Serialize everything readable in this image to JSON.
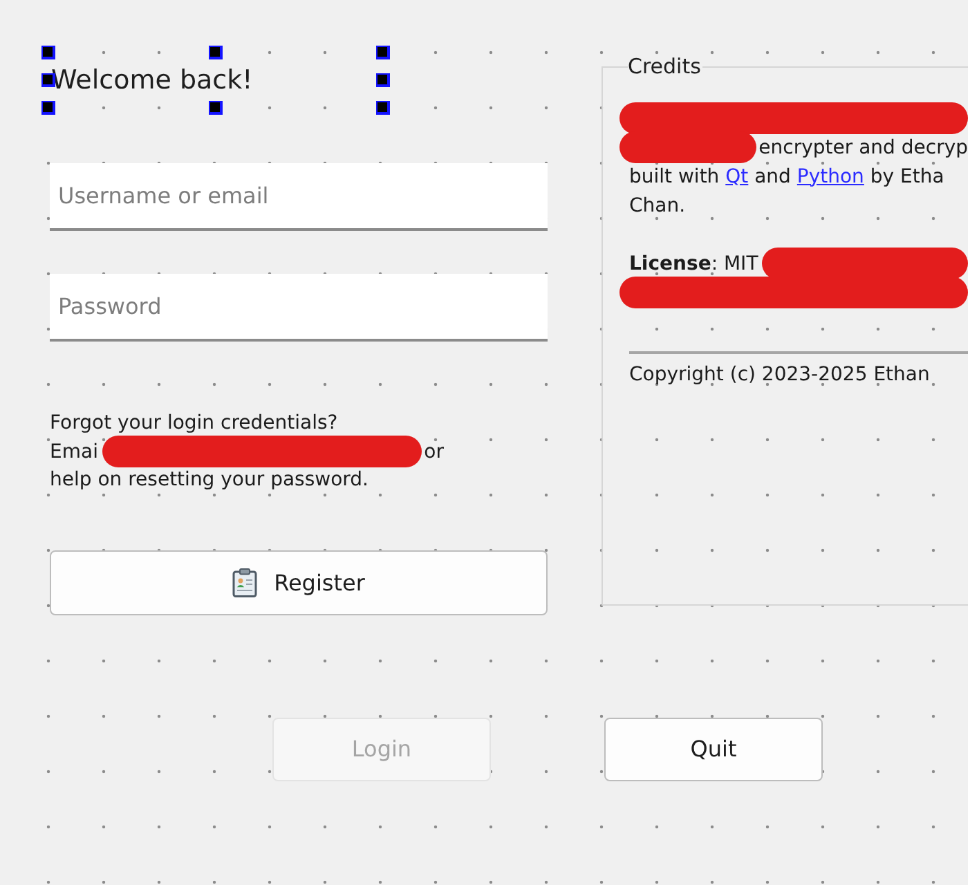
{
  "heading": {
    "text": "Welcome back!",
    "selected": true
  },
  "fields": [
    {
      "placeholder": "Username or email"
    },
    {
      "placeholder": "Password"
    }
  ],
  "help": {
    "lines": [
      [
        {
          "kind": "text",
          "text": "Forgot your login credentials?"
        }
      ],
      [
        {
          "kind": "text",
          "text": "Emai"
        },
        {
          "kind": "redaction"
        },
        {
          "kind": "text",
          "text": "or"
        }
      ],
      [
        {
          "kind": "text",
          "text": "help on resetting your password."
        }
      ]
    ]
  },
  "register_button": {
    "label": "Register"
  },
  "credits": {
    "title": "Credits",
    "paragraphs": [
      {
        "lines": [
          [
            {
              "kind": "redaction"
            }
          ],
          [
            {
              "kind": "redaction"
            },
            {
              "kind": "text",
              "text": "encrypter and decryp"
            }
          ],
          [
            {
              "kind": "text",
              "text": "built with "
            },
            {
              "kind": "link",
              "text": "Qt"
            },
            {
              "kind": "text",
              "text": " and "
            },
            {
              "kind": "link",
              "text": "Python"
            },
            {
              "kind": "text",
              "text": " by Etha"
            }
          ],
          [
            {
              "kind": "text",
              "text": "Chan."
            }
          ]
        ]
      },
      {
        "lines": [
          [
            {
              "kind": "text",
              "text": "**License**: MIT"
            },
            {
              "kind": "redaction"
            }
          ],
          [
            {
              "kind": "redaction"
            }
          ]
        ]
      }
    ],
    "copyright": "Copyright (c) 2023-2025 Ethan"
  },
  "buttons": [
    {
      "label": "Login",
      "disabled": true
    },
    {
      "label": "Quit",
      "disabled": false
    }
  ]
}
